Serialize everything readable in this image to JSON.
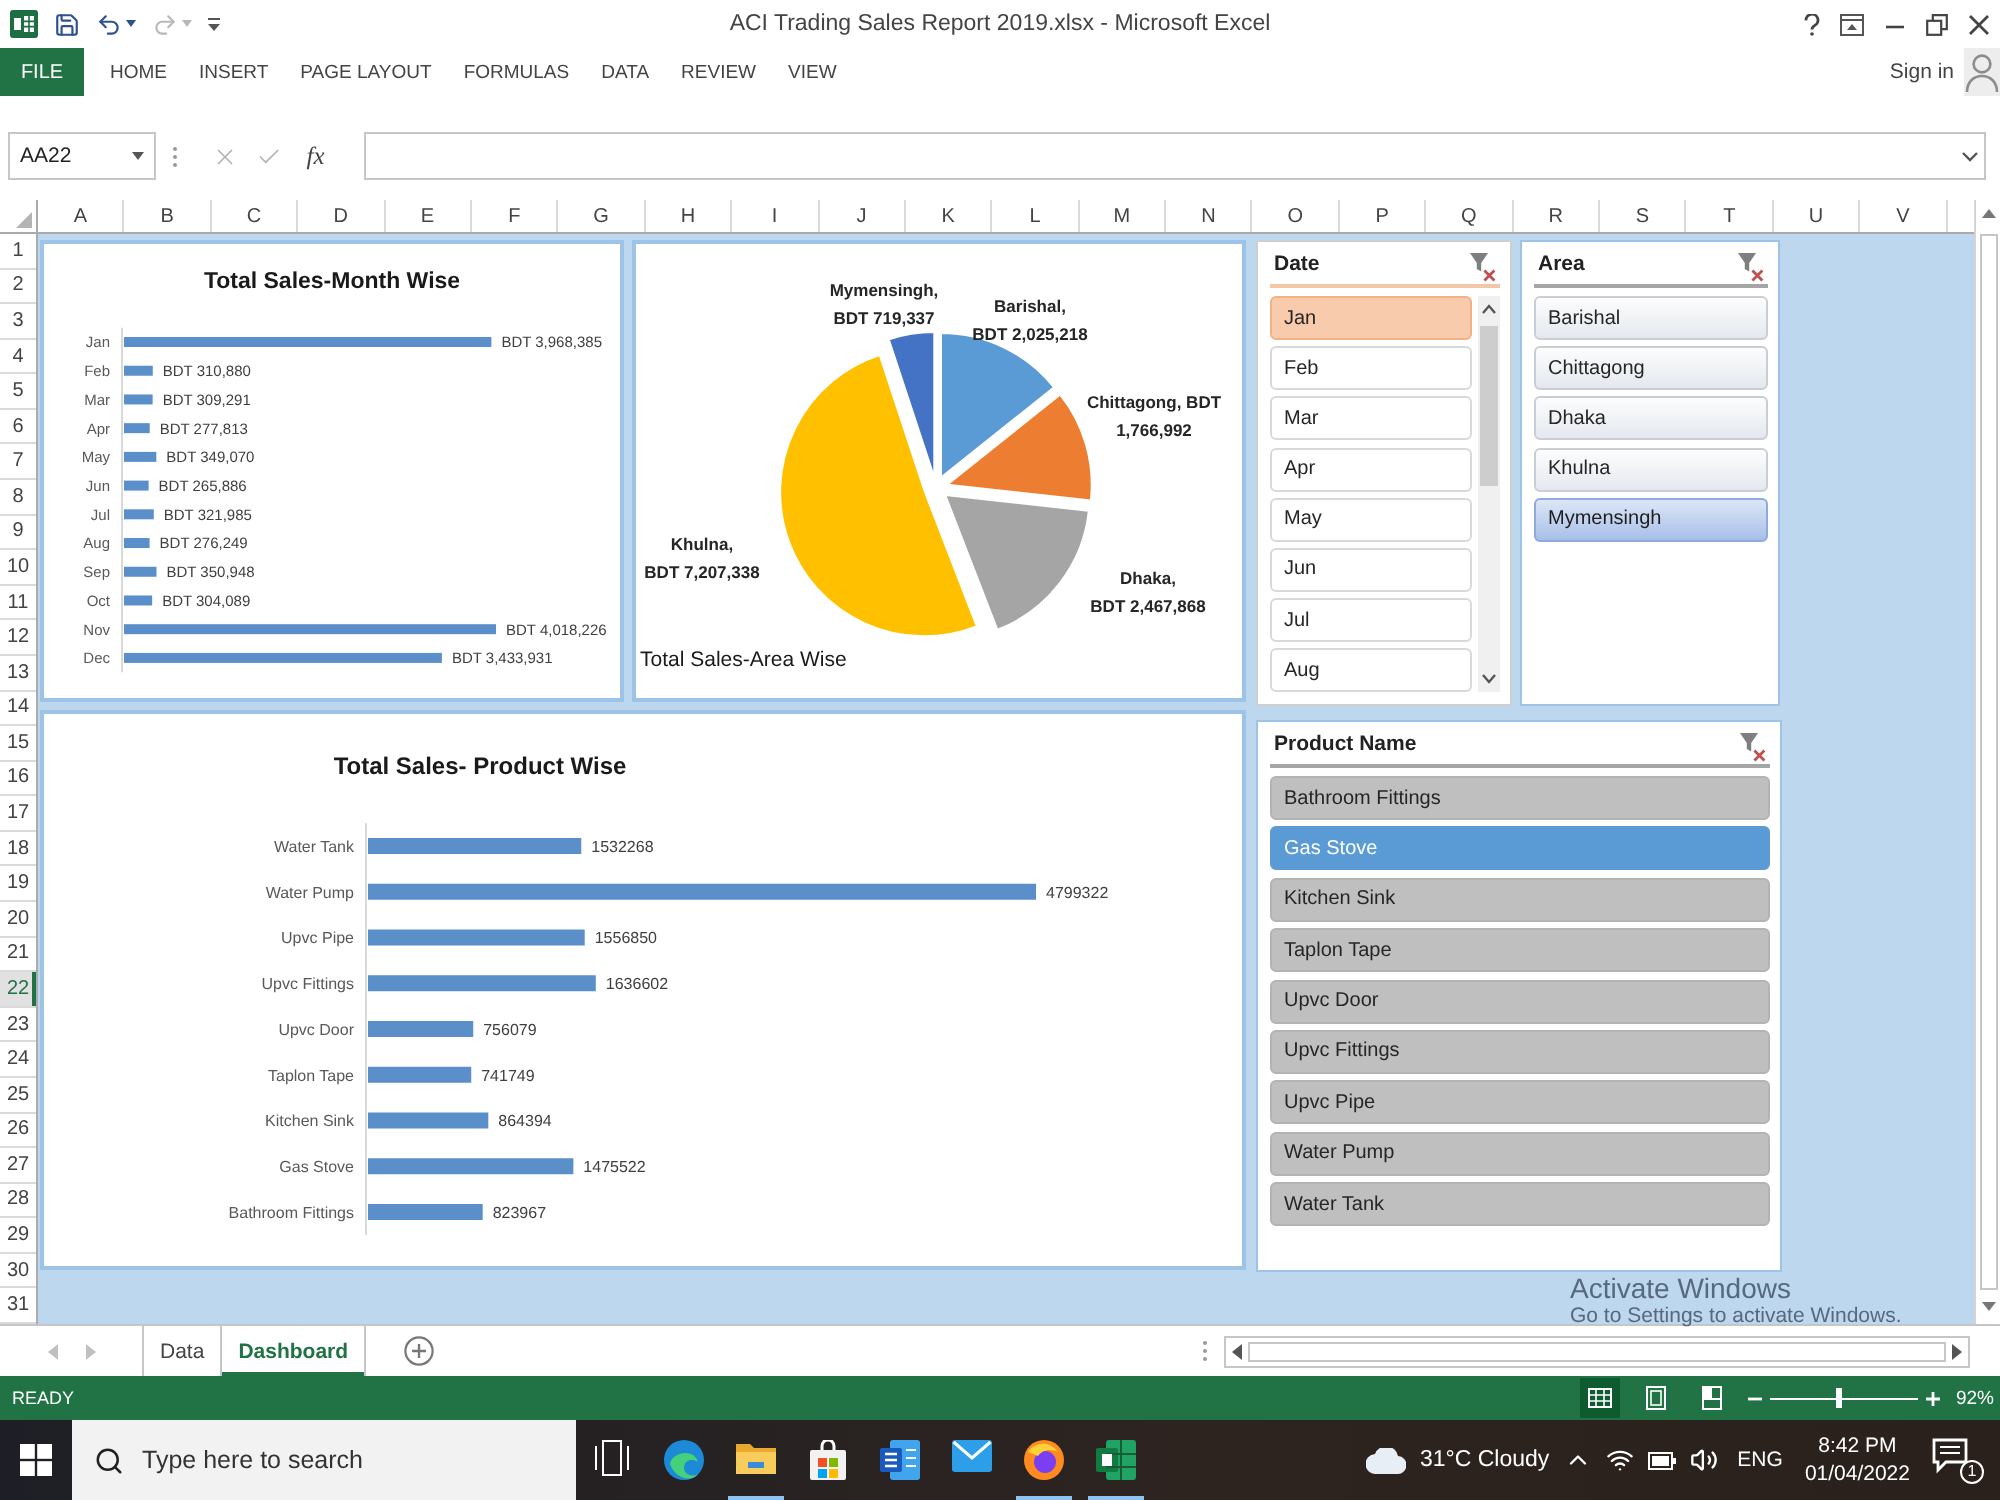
{
  "window": {
    "title": "ACI Trading Sales Report 2019.xlsx - Microsoft Excel",
    "quick_access": [
      {
        "kind": "save",
        "disabled": false
      },
      {
        "kind": "undo",
        "disabled": false
      },
      {
        "kind": "redo",
        "disabled": true
      }
    ]
  },
  "ribbon": {
    "file_tab": "FILE",
    "tabs": [
      "HOME",
      "INSERT",
      "PAGE LAYOUT",
      "FORMULAS",
      "DATA",
      "REVIEW",
      "VIEW"
    ],
    "sign_in": "Sign in"
  },
  "formula_bar": {
    "name_box": "AA22",
    "buttons": [
      {
        "kind": "cancel",
        "disabled": true
      },
      {
        "kind": "enter",
        "disabled": true
      }
    ],
    "insert_function": "fx"
  },
  "sheet": {
    "columns": [
      "A",
      "B",
      "C",
      "D",
      "E",
      "F",
      "G",
      "H",
      "I",
      "J",
      "K",
      "L",
      "M",
      "N",
      "O",
      "P",
      "Q",
      "R",
      "S",
      "T",
      "U",
      "V"
    ],
    "rows": [
      {
        "label": "1",
        "selected": false
      },
      {
        "label": "2",
        "selected": false
      },
      {
        "label": "3",
        "selected": false
      },
      {
        "label": "4",
        "selected": false
      },
      {
        "label": "5",
        "selected": false
      },
      {
        "label": "6",
        "selected": false
      },
      {
        "label": "7",
        "selected": false
      },
      {
        "label": "8",
        "selected": false
      },
      {
        "label": "9",
        "selected": false
      },
      {
        "label": "10",
        "selected": false
      },
      {
        "label": "11",
        "selected": false
      },
      {
        "label": "12",
        "selected": false
      },
      {
        "label": "13",
        "selected": false
      },
      {
        "label": "14",
        "selected": false
      },
      {
        "label": "15",
        "selected": false
      },
      {
        "label": "16",
        "selected": false
      },
      {
        "label": "17",
        "selected": false
      },
      {
        "label": "18",
        "selected": false
      },
      {
        "label": "19",
        "selected": false
      },
      {
        "label": "20",
        "selected": false
      },
      {
        "label": "21",
        "selected": false
      },
      {
        "label": "22",
        "selected": true
      },
      {
        "label": "23",
        "selected": false
      },
      {
        "label": "24",
        "selected": false
      },
      {
        "label": "25",
        "selected": false
      },
      {
        "label": "26",
        "selected": false
      },
      {
        "label": "27",
        "selected": false
      },
      {
        "label": "28",
        "selected": false
      },
      {
        "label": "29",
        "selected": false
      },
      {
        "label": "30",
        "selected": false
      },
      {
        "label": "31",
        "selected": false
      }
    ]
  },
  "month_chart": {
    "chart_data": {
      "type": "bar",
      "orientation": "horizontal",
      "title": "Total Sales-Month Wise",
      "categories": [
        "Jan",
        "Feb",
        "Mar",
        "Apr",
        "May",
        "Jun",
        "Jul",
        "Aug",
        "Sep",
        "Oct",
        "Nov",
        "Dec"
      ],
      "values": [
        3968385,
        310880,
        309291,
        277813,
        349070,
        265886,
        321985,
        276249,
        350948,
        304089,
        4018226,
        3433931
      ],
      "value_labels": [
        "BDT 3,968,385",
        "BDT 310,880",
        "BDT 309,291",
        "BDT 277,813",
        "BDT 349,070",
        "BDT 265,886",
        "BDT 321,985",
        "BDT 276,249",
        "BDT 350,948",
        "BDT 304,089",
        "BDT 4,018,226",
        "BDT 3,433,931"
      ]
    }
  },
  "area_chart": {
    "chart_data": {
      "type": "pie",
      "title": "Total Sales-Area Wise",
      "categories": [
        "Barishal",
        "Chittagong",
        "Dhaka",
        "Khulna",
        "Mymensingh"
      ],
      "values": [
        2025218,
        1766992,
        2467868,
        7207338,
        719337
      ],
      "colors": [
        "#5b9bd5",
        "#ed7d31",
        "#a5a5a5",
        "#ffc000",
        "#4472c4"
      ],
      "value_labels": [
        ",\nBDT 2,025,218",
        ", BDT\n1,766,992",
        ",\nBDT 2,467,868",
        ",\nBDT 7,207,338",
        ",\nBDT 719,337"
      ]
    }
  },
  "date_slicer": {
    "title": "Date",
    "items": [
      {
        "label": "Jan",
        "selected": true
      },
      {
        "label": "Feb",
        "selected": false
      },
      {
        "label": "Mar",
        "selected": false
      },
      {
        "label": "Apr",
        "selected": false
      },
      {
        "label": "May",
        "selected": false
      },
      {
        "label": "Jun",
        "selected": false
      },
      {
        "label": "Jul",
        "selected": false
      },
      {
        "label": "Aug",
        "selected": false
      }
    ]
  },
  "area_slicer": {
    "title": "Area",
    "items": [
      {
        "label": "Barishal",
        "selected": false
      },
      {
        "label": "Chittagong",
        "selected": false
      },
      {
        "label": "Dhaka",
        "selected": false
      },
      {
        "label": "Khulna",
        "selected": false
      },
      {
        "label": "Mymensingh",
        "selected": true
      }
    ]
  },
  "product_chart": {
    "chart_data": {
      "type": "bar",
      "orientation": "horizontal",
      "title": "Total Sales- Product Wise",
      "categories": [
        "Water Tank",
        "Water Pump",
        "Upvc Pipe",
        "Upvc Fittings",
        "Upvc Door",
        "Taplon Tape",
        "Kitchen Sink",
        "Gas Stove",
        "Bathroom Fittings"
      ],
      "values": [
        1532268,
        4799322,
        1556850,
        1636602,
        756079,
        741749,
        864394,
        1475522,
        823967
      ],
      "data_labels": true
    }
  },
  "product_slicer": {
    "title": "Product Name",
    "items": [
      {
        "label": "Bathroom Fittings",
        "selected": false
      },
      {
        "label": "Gas Stove",
        "selected": true
      },
      {
        "label": "Kitchen Sink",
        "selected": false
      },
      {
        "label": "Taplon Tape",
        "selected": false
      },
      {
        "label": "Upvc Door",
        "selected": false
      },
      {
        "label": "Upvc Fittings",
        "selected": false
      },
      {
        "label": "Upvc Pipe",
        "selected": false
      },
      {
        "label": "Water Pump",
        "selected": false
      },
      {
        "label": "Water Tank",
        "selected": false
      }
    ]
  },
  "activation_notice": {
    "title": "Activate Windows",
    "text": "Go to Settings to activate Windows."
  },
  "sheet_tabs": [
    {
      "label": "Data",
      "selected": false
    },
    {
      "label": "Dashboard",
      "selected": true
    }
  ],
  "status_bar": {
    "mode": "READY",
    "views": [
      {
        "kind": "normal",
        "selected": true
      },
      {
        "kind": "page-layout",
        "selected": false
      },
      {
        "kind": "page-break",
        "selected": false
      }
    ],
    "zoom": {
      "level": 0.46
    },
    "zoom_reading": "92%"
  },
  "taskbar": {
    "search_placeholder": "Type here to search",
    "apps": [
      {
        "kind": "task-view",
        "running": false
      },
      {
        "kind": "browser",
        "running": false
      },
      {
        "kind": "folder",
        "running": true
      },
      {
        "kind": "store",
        "running": false
      },
      {
        "kind": "document",
        "running": false
      },
      {
        "kind": "mail",
        "running": false
      },
      {
        "kind": "globe-browser",
        "running": true
      },
      {
        "kind": "spreadsheet",
        "running": true
      }
    ],
    "weather": "31°C Cloudy",
    "language": "ENG",
    "time": "8:42 PM",
    "date": "01/04/2022",
    "notification_count": "1"
  }
}
